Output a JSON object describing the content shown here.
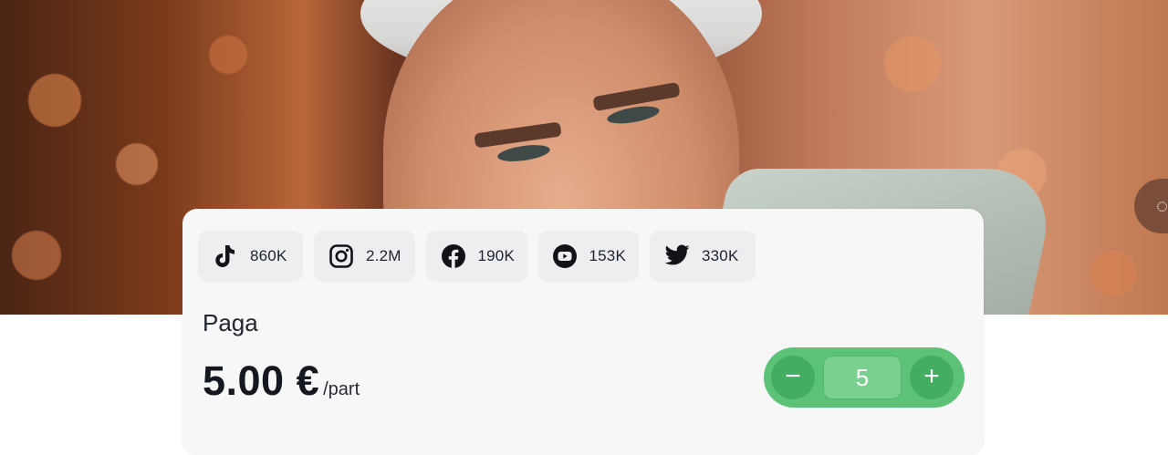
{
  "socials": [
    {
      "network": "tiktok",
      "icon": "tiktok-icon",
      "count": "860K"
    },
    {
      "network": "instagram",
      "icon": "instagram-icon",
      "count": "2.2M"
    },
    {
      "network": "facebook",
      "icon": "facebook-icon",
      "count": "190K"
    },
    {
      "network": "youtube",
      "icon": "youtube-icon",
      "count": "153K"
    },
    {
      "network": "twitter",
      "icon": "twitter-icon",
      "count": "330K"
    }
  ],
  "payment": {
    "label": "Paga",
    "price": "5.00 €",
    "unit": "/part"
  },
  "quantity": {
    "value": "5",
    "decrement_label": "−",
    "increment_label": "+"
  },
  "colors": {
    "accent_green": "#5cc277",
    "card_bg": "#f7f7f8",
    "chip_bg": "#eceef0"
  }
}
